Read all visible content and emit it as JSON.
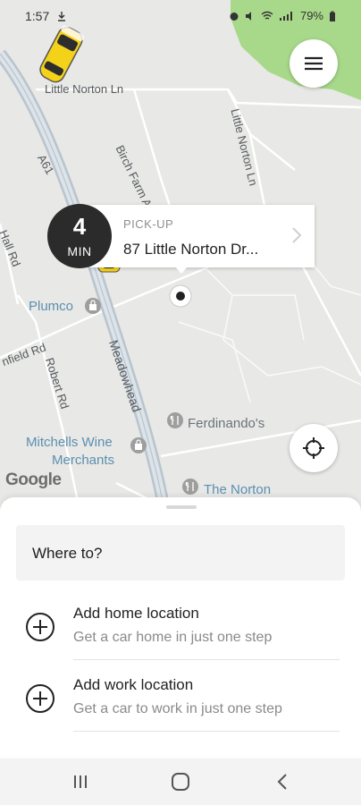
{
  "status_bar": {
    "time": "1:57",
    "battery": "79%"
  },
  "map": {
    "roads": {
      "little_norton_ln_top": "Little Norton Ln",
      "birch_farm_ave": "Birch Farm Ave",
      "little_norton_ln_right": "Little Norton Ln",
      "a61": "A61",
      "hall_rd": "Hall Rd",
      "enfield_rd": "nfield Rd",
      "robert_rd": "Robert Rd",
      "meadowhead": "Meadowhead"
    },
    "pois": {
      "plumco": "Plumco",
      "ferdinandos": "Ferdinando's",
      "mitchells_line1": "Mitchells Wine",
      "mitchells_line2": "Merchants",
      "the_norton": "The Norton"
    },
    "attribution": "Google"
  },
  "eta": {
    "value": "4",
    "unit": "MIN"
  },
  "pickup": {
    "label": "PICK-UP",
    "address": "87 Little Norton Dr..."
  },
  "sheet": {
    "search_placeholder": "Where to?",
    "shortcuts": [
      {
        "title": "Add home location",
        "subtitle": "Get a car home in just one step"
      },
      {
        "title": "Add work location",
        "subtitle": "Get a car to work in just one step"
      }
    ]
  },
  "colors": {
    "map_background": "#e8e8e6",
    "park": "#a8d98a",
    "eta_circle": "#2b2b2b",
    "taxi_yellow": "#f5d21a"
  }
}
